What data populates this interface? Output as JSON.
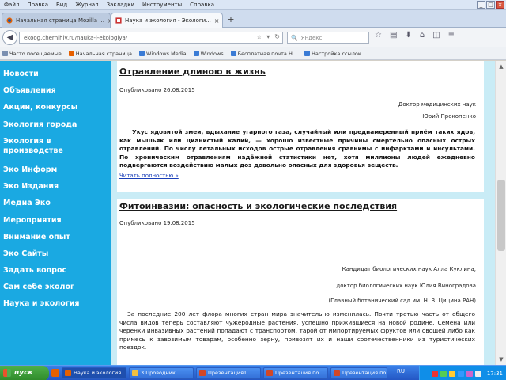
{
  "menu": [
    "Файл",
    "Правка",
    "Вид",
    "Журнал",
    "Закладки",
    "Инструменты",
    "Справка"
  ],
  "tabs": [
    {
      "label": "Начальная страница Mozilla ...",
      "close": "×"
    },
    {
      "label": "Наука и экология - Экологи...",
      "close": "×"
    }
  ],
  "newtab_label": "+",
  "address": {
    "url": "ekoog.chernihiv.ru/nauka-i-ekologiya/",
    "search_placeholder": "Яндекс"
  },
  "bookmarks": [
    "Часто посещаемые",
    "Начальная страница",
    "Windows Media",
    "Windows",
    "Бесплатная почта H...",
    "Настройка ссылок"
  ],
  "sidebar": {
    "items": [
      "Новости",
      "Объявления",
      "Акции, конкурсы",
      "Экология города",
      "Экология в",
      "производстве",
      "Эко Информ",
      "Эко Издания",
      "Медиа Эко",
      "Мероприятия",
      "Внимание опыт",
      "Эко Сайты",
      "Задать вопрос",
      "Сам себе эколог",
      "Наука и экология"
    ]
  },
  "articles": [
    {
      "title": "Отравление длиною в жизнь",
      "date": "Опубликовано 26.08.2015",
      "author_title": "Доктор медицинских наук",
      "author_name": "Юрий Прокопенко",
      "lead": "Укус ядовитой змеи, вдыхание угарного газа, случайный или преднамеренный приём таких ядов, как мышьяк или цианистый калий, — хорошо известные причины смертельно опасных острых отравлений. По числу летальных исходов острые отравления сравнимы с инфарктами и инсультами. По хроническим отравлениям надёжной статистики нет, хотя миллионы людей ежедневно подвергаются воздействию малых доз довольно опасных для здоровья веществ.",
      "readmore": "Читать полностью »"
    },
    {
      "title": "Фитоинвазии: опасность и экологические последствия",
      "date": "Опубликовано 19.08.2015",
      "author1": "Кандидат биологических наук Алла Куклина,",
      "author2": "доктор биологических наук Юлия Виноградова",
      "org": "(Главный ботанический сад им. Н. В. Цицина РАН)",
      "body": "За последние 200 лет флора многих стран мира значительно изменилась. Почти третью часть от общего числа видов теперь составляют чужеродные растения, успешно прижившиеся на новой родине. Семена или черенки инвазивных растений попадают с транспортом, тарой от импортируемых фруктов или овощей либо как примесь к завозимым товарам, особенно зерну, привозят их и наши соотечественники из туристических поездок."
    }
  ],
  "taskbar": {
    "start": "пуск",
    "tasks": [
      "Наука и экология ...",
      "3 Проводник",
      "Презентация1",
      "Презентация по...",
      "Презентация по..."
    ],
    "lang": "RU",
    "clock": "17:31"
  },
  "colors": {
    "sidebar": "#1aa9e2",
    "accent_bg": "#c9ecf6",
    "taskbar": "#2457c4"
  }
}
